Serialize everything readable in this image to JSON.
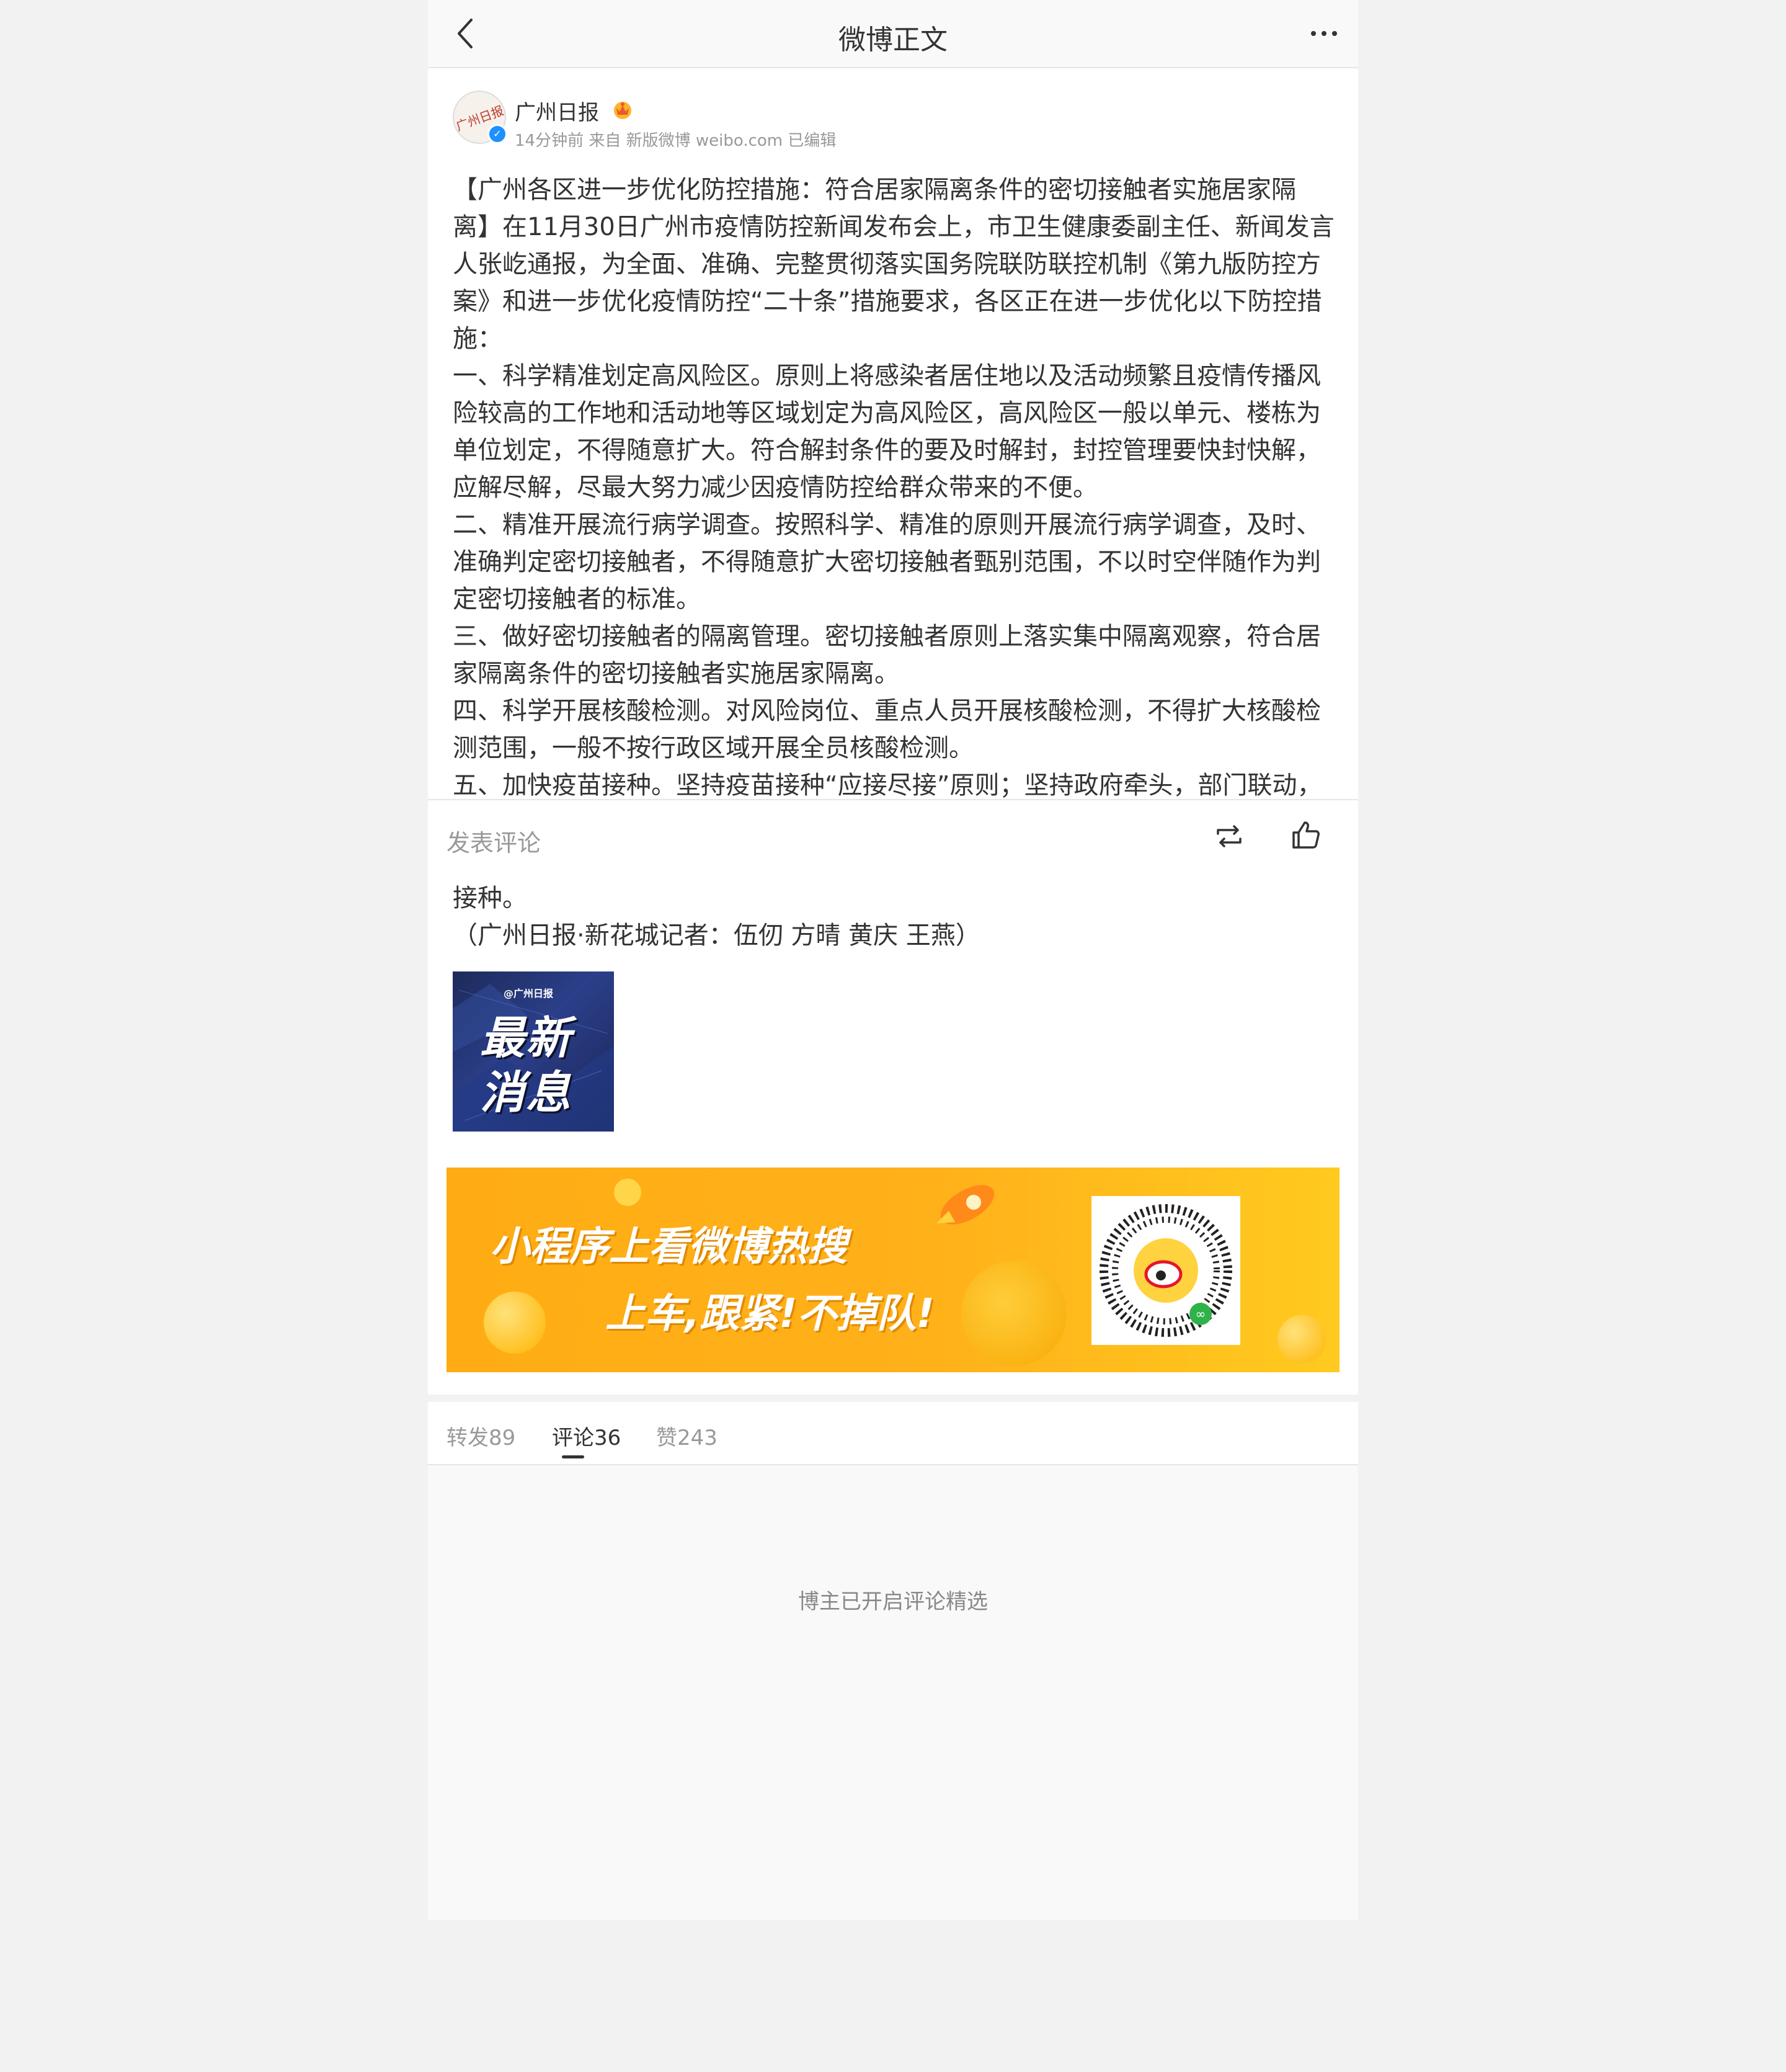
{
  "header": {
    "title": "微博正文"
  },
  "author": {
    "name": "广州日报",
    "avatar_text": "广州日报",
    "meta": "14分钟前 来自 新版微博 weibo.com 已编辑"
  },
  "post": {
    "lines": [
      "【广州各区进一步优化防控措施：符合居家隔离条件的密切接触者实施居家隔",
      "离】在11月30日广州市疫情防控新闻发布会上，市卫生健康委副主任、新闻发言",
      "人张屹通报，为全面、准确、完整贯彻落实国务院联防联控机制《第九版防控方",
      "案》和进一步优化疫情防控“二十条”措施要求，各区正在进一步优化以下防控措",
      "施：",
      "一、科学精准划定高风险区。原则上将感染者居住地以及活动频繁且疫情传播风",
      "险较高的工作地和活动地等区域划定为高风险区，高风险区一般以单元、楼栋为",
      "单位划定，不得随意扩大。符合解封条件的要及时解封，封控管理要快封快解，",
      "应解尽解，尽最大努力减少因疫情防控给群众带来的不便。",
      "二、精准开展流行病学调查。按照科学、精准的原则开展流行病学调查，及时、",
      "准确判定密切接触者，不得随意扩大密切接触者甄别范围，不以时空伴随作为判",
      "定密切接触者的标准。",
      "三、做好密切接触者的隔离管理。密切接触者原则上落实集中隔离观察，符合居",
      "家隔离条件的密切接触者实施居家隔离。",
      "四、科学开展核酸检测。对风险岗位、重点人员开展核酸检测，不得扩大核酸检",
      "测范围，一般不按行政区域开展全员核酸检测。",
      "五、加快疫苗接种。坚持疫苗接种“应接尽接”原则；坚持政府牵头，部门联动，"
    ],
    "tail_lines": [
      "接种。",
      "（广州日报·新花城记者：伍仞 方晴 黄庆 王燕）"
    ],
    "image": {
      "tag": "@广州日报",
      "line1": "最新",
      "line2": "消息"
    }
  },
  "comment_bar": {
    "placeholder": "发表评论"
  },
  "banner": {
    "line1": "小程序上看微博热搜",
    "line2": "上车,跟紧!不掉队!"
  },
  "tabs": [
    {
      "label": "转发89"
    },
    {
      "label": "评论36"
    },
    {
      "label": "赞243"
    }
  ],
  "comments": {
    "empty_note": "博主已开启评论精选"
  },
  "colors": {
    "page_bg": "#f2f2f2",
    "banner": "#ffb11a",
    "verified": "#1e90ff"
  }
}
